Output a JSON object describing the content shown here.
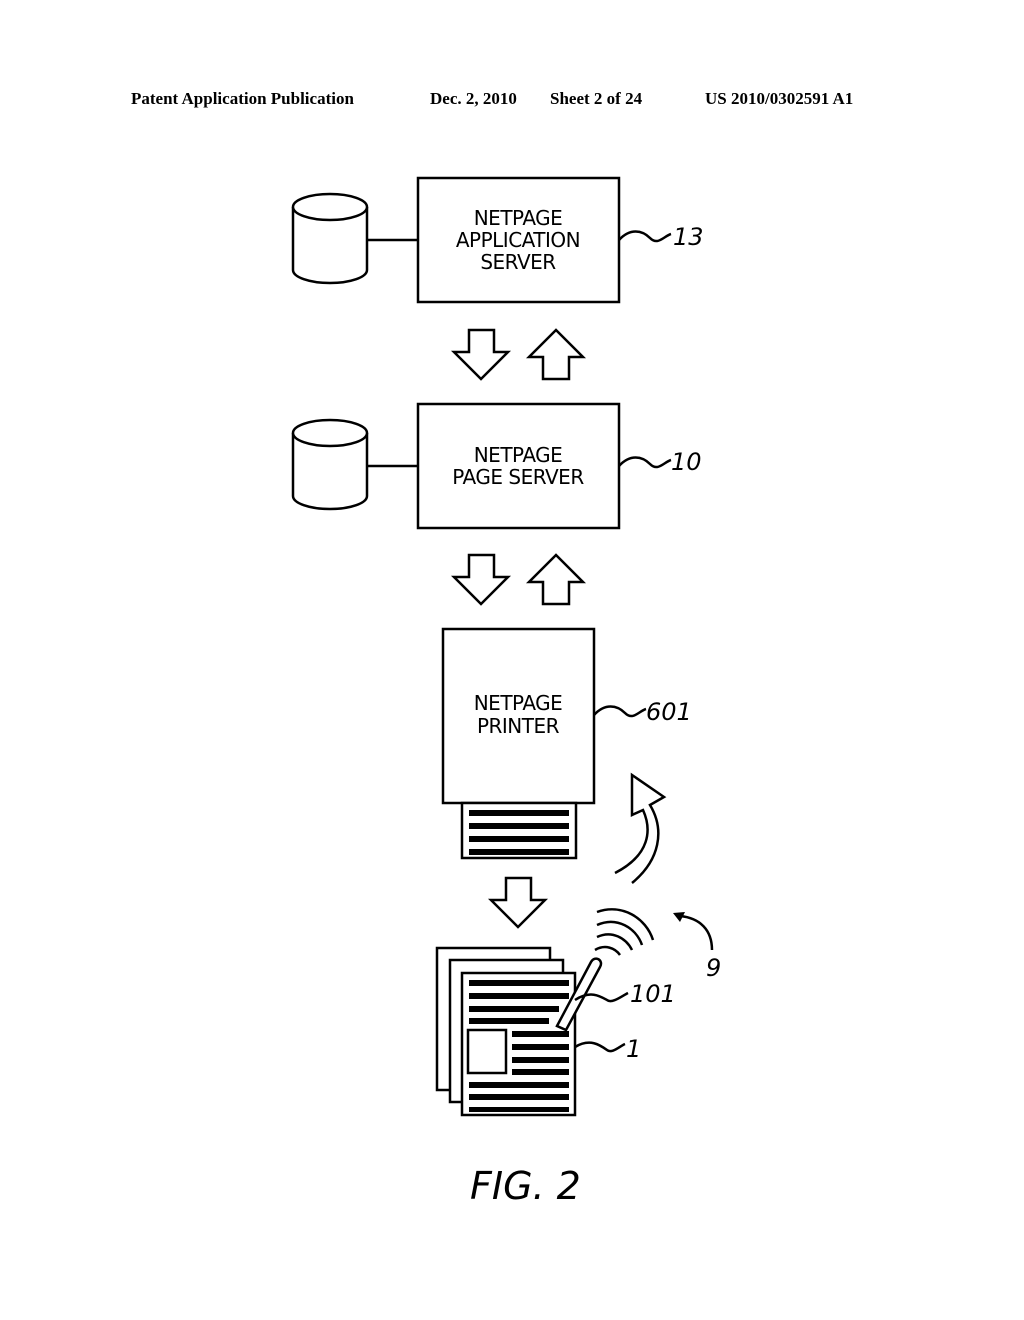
{
  "header": {
    "publication": "Patent Application Publication",
    "date": "Dec. 2, 2010",
    "sheet": "Sheet 2 of 24",
    "number": "US 2010/0302591 A1"
  },
  "diagram": {
    "nodes": [
      {
        "id": "app-server",
        "lines": [
          "NETPAGE",
          "APPLICATION",
          "SERVER"
        ],
        "ref": "13",
        "has_database": true
      },
      {
        "id": "page-server",
        "lines": [
          "NETPAGE",
          "PAGE SERVER"
        ],
        "ref": "10",
        "has_database": true
      },
      {
        "id": "printer",
        "lines": [
          "NETPAGE",
          "PRINTER"
        ],
        "ref": "601"
      }
    ],
    "refs": {
      "pen": "101",
      "document": "1",
      "interaction": "9"
    },
    "edges": [
      {
        "from": "app-server",
        "to": "page-server",
        "type": "bidirectional"
      },
      {
        "from": "page-server",
        "to": "printer",
        "type": "bidirectional"
      },
      {
        "from": "printer",
        "to": "document",
        "type": "down"
      },
      {
        "from": "pen",
        "to": "printer",
        "type": "wireless-return"
      }
    ],
    "caption": "FIG. 2"
  }
}
